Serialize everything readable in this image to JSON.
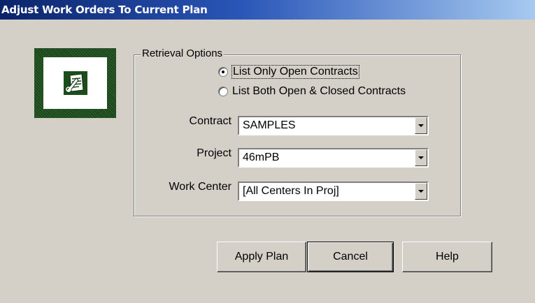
{
  "window": {
    "title": "Adjust Work Orders To Current Plan"
  },
  "logo": {
    "icon": "document-pencil-icon"
  },
  "retrieval": {
    "legend": "Retrieval Options",
    "options": [
      {
        "label": "List Only Open Contracts",
        "checked": true
      },
      {
        "label": "List Both Open & Closed Contracts",
        "checked": false
      }
    ]
  },
  "fields": {
    "contract": {
      "label": "Contract",
      "value": "SAMPLES"
    },
    "project": {
      "label": "Project",
      "value": "46mPB"
    },
    "work_center": {
      "label": "Work Center",
      "value": "[All Centers In Proj]"
    }
  },
  "buttons": {
    "apply": "Apply Plan",
    "cancel": "Cancel",
    "help": "Help"
  }
}
